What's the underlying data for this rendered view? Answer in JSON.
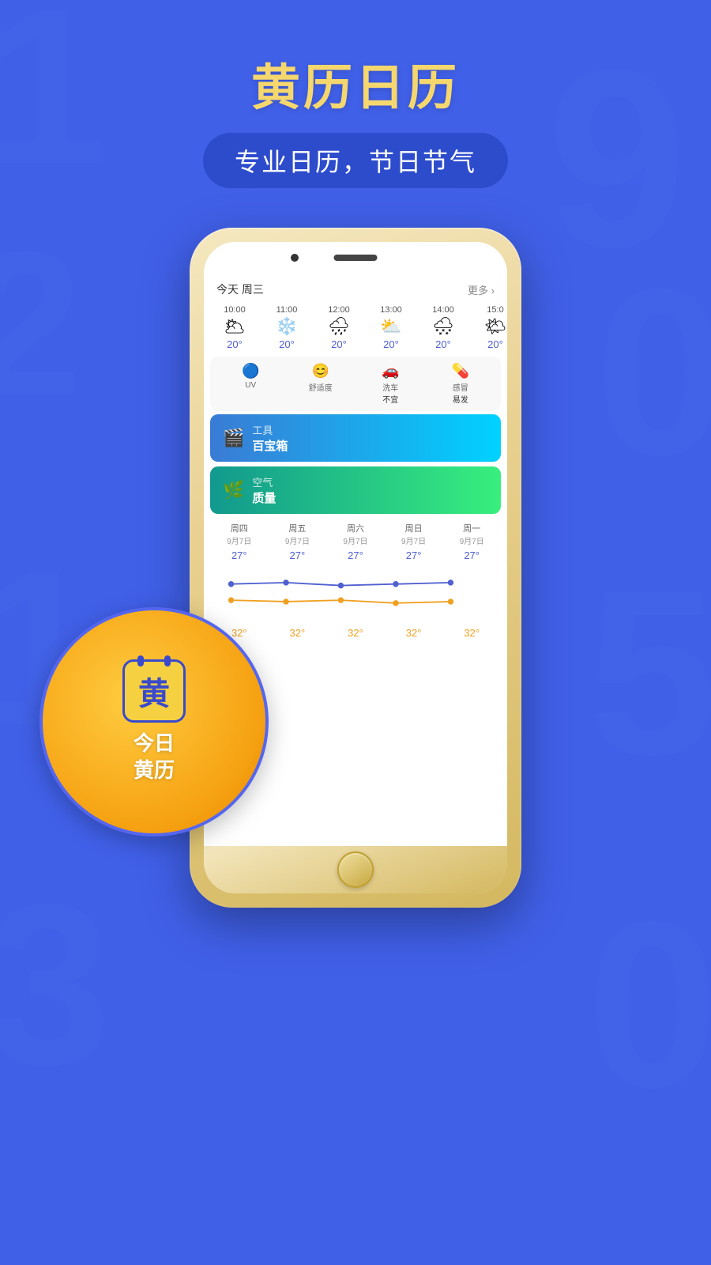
{
  "background_color": "#4060e8",
  "bg_numbers": [
    "1",
    "9",
    "2",
    "0",
    "1",
    "5",
    "3",
    "0"
  ],
  "header": {
    "title": "黄历日历",
    "subtitle": "专业日历，节日节气"
  },
  "phone": {
    "today_label": "今天 周三",
    "more_label": "更多 ›",
    "hourly": [
      {
        "time": "10:00",
        "icon": "🌥",
        "temp": "20°"
      },
      {
        "time": "11:00",
        "icon": "❄",
        "temp": "20°"
      },
      {
        "time": "12:00",
        "icon": "🌧",
        "temp": "20°"
      },
      {
        "time": "13:00",
        "icon": "⛅",
        "temp": "20°"
      },
      {
        "time": "14:00",
        "icon": "🌨",
        "temp": "20°"
      },
      {
        "time": "15:0",
        "icon": "🌤",
        "temp": "20°"
      }
    ],
    "life_index": [
      {
        "icon": "🔵",
        "label": "UV",
        "value": ""
      },
      {
        "icon": "😊",
        "label": "舒适度",
        "value": ""
      },
      {
        "icon": "🚗",
        "label": "洗车",
        "value": "不宜"
      },
      {
        "icon": "💊",
        "label": "感冒",
        "value": "易发"
      }
    ],
    "features": [
      {
        "icon": "🎬",
        "main_label": "工具",
        "sub_label": "百宝箱",
        "color": "blue"
      },
      {
        "icon": "🌿",
        "main_label": "空气",
        "sub_label": "质量",
        "color": "teal"
      }
    ],
    "weekly": [
      {
        "day": "周四",
        "date": "9月7日",
        "high": "27°",
        "low": "32°"
      },
      {
        "day": "周五",
        "date": "9月7日",
        "high": "27°",
        "low": "32°"
      },
      {
        "day": "周六",
        "date": "9月7日",
        "high": "27°",
        "low": "32°"
      },
      {
        "day": "周日",
        "date": "9月7日",
        "high": "27°",
        "low": "32°"
      },
      {
        "day": "周一",
        "date": "9月7日",
        "high": "27°",
        "low": "32°"
      }
    ]
  },
  "orange_circle": {
    "calendar_char": "黄",
    "label_line1": "今日",
    "label_line2": "黄历"
  }
}
